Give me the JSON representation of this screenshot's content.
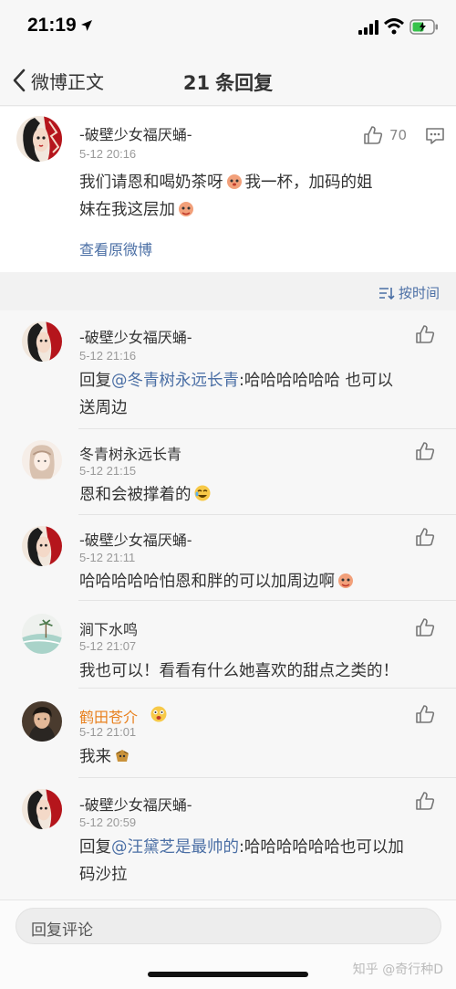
{
  "status_bar": {
    "time": "21:19"
  },
  "nav": {
    "back_label": "微博正文",
    "title_count": "21",
    "title_text": "条回复"
  },
  "root_comment": {
    "name": "-破壁少女福厌蛹-",
    "time": "5-12 20:16",
    "likes": "70",
    "text_1": "我们请恩和喝奶茶呀",
    "text_2": "我一杯，加码的姐",
    "text_3": "妹在我这层加",
    "view_original": "查看原微博"
  },
  "sort": {
    "label": "按时间"
  },
  "replies": [
    {
      "name": "-破壁少女福厌蛹-",
      "time": "5-12 21:16",
      "prefix": "回复",
      "mention": "@冬青树永远长青",
      "text_1": ":哈哈哈哈哈哈 也可以",
      "text_2": "送周边"
    },
    {
      "name": "冬青树永远长青",
      "time": "5-12 21:15",
      "text_1": "恩和会被撑着的"
    },
    {
      "name": "-破壁少女福厌蛹-",
      "time": "5-12 21:11",
      "text_1": "哈哈哈哈哈怕恩和胖的可以加周边啊"
    },
    {
      "name": "涧下水鸣",
      "time": "5-12 21:07",
      "text_1": "我也可以！看看有什么她喜欢的甜点之类的！"
    },
    {
      "name": "鹤田苍介",
      "time": "5-12 21:01",
      "text_1": "我来"
    },
    {
      "name": "-破壁少女福厌蛹-",
      "time": "5-12 20:59",
      "prefix": "回复",
      "mention": "@汪黛芝是最帅的",
      "text_1": ":哈哈哈哈哈哈也可以加",
      "text_2": "码沙拉"
    }
  ],
  "bottom": {
    "placeholder": "回复评论",
    "watermark": "知乎 @奇行种D"
  },
  "colors": {
    "link": "#4b6fa5",
    "vip_name": "#e8801e",
    "background": "#f7f7f7"
  },
  "icons": [
    "back-chevron-icon",
    "thumbs-up-icon",
    "comment-more-icon",
    "sort-time-icon",
    "emoji-icon"
  ]
}
